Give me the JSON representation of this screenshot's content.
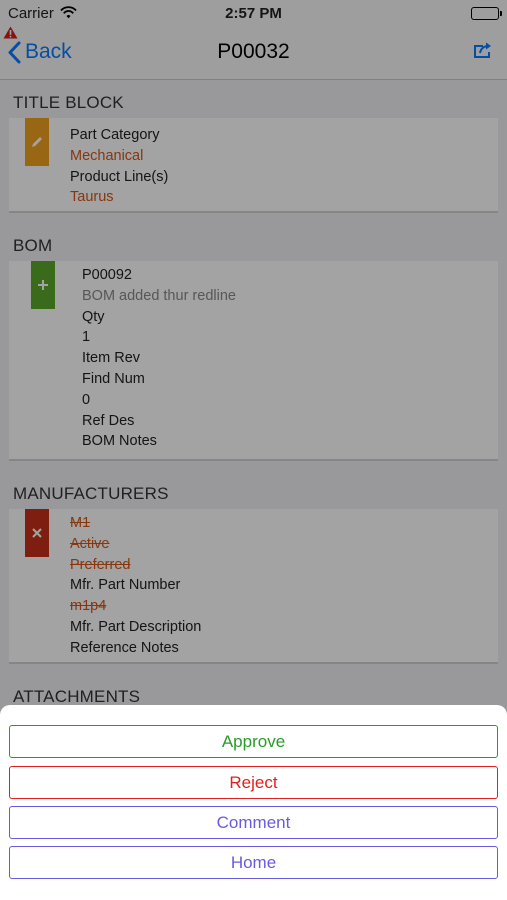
{
  "status_bar": {
    "carrier": "Carrier",
    "time": "2:57 PM"
  },
  "nav": {
    "back_label": "Back",
    "title": "P00032"
  },
  "title_block": {
    "header": "TITLE BLOCK",
    "badge_color": "#f0a020",
    "fields": [
      {
        "label": "Part Category",
        "value": "Mechanical"
      },
      {
        "label": "Product Line(s)",
        "value": "Taurus"
      }
    ]
  },
  "bom": {
    "header": "BOM",
    "badge_color": "#5ba82a",
    "item_number": "P00092",
    "note": "BOM added thur redline",
    "qty_label": "Qty",
    "qty_value": "1",
    "item_rev_label": "Item Rev",
    "find_num_label": "Find Num",
    "find_num_value": "0",
    "ref_des_label": "Ref Des",
    "bom_notes_label": "BOM Notes"
  },
  "manufacturers": {
    "header": "MANUFACTURERS",
    "badge_color": "#c4301a",
    "name": "M1",
    "status": "Active",
    "preferred": "Preferred",
    "part_number_label": "Mfr. Part Number",
    "part_number_value": "m1p4",
    "part_description_label": "Mfr. Part Description",
    "reference_notes_label": "Reference Notes"
  },
  "attachments": {
    "header": "ATTACHMENTS"
  },
  "action_sheet": {
    "approve": {
      "label": "Approve",
      "color": "#2a9a2a"
    },
    "reject": {
      "label": "Reject",
      "color": "#e02020"
    },
    "comment": {
      "label": "Comment",
      "color": "#6a5ae0"
    },
    "home": {
      "label": "Home",
      "color": "#6a5ae0"
    }
  },
  "colors": {
    "ios_blue": "#0a7aff",
    "changed_value": "#d2561a"
  }
}
